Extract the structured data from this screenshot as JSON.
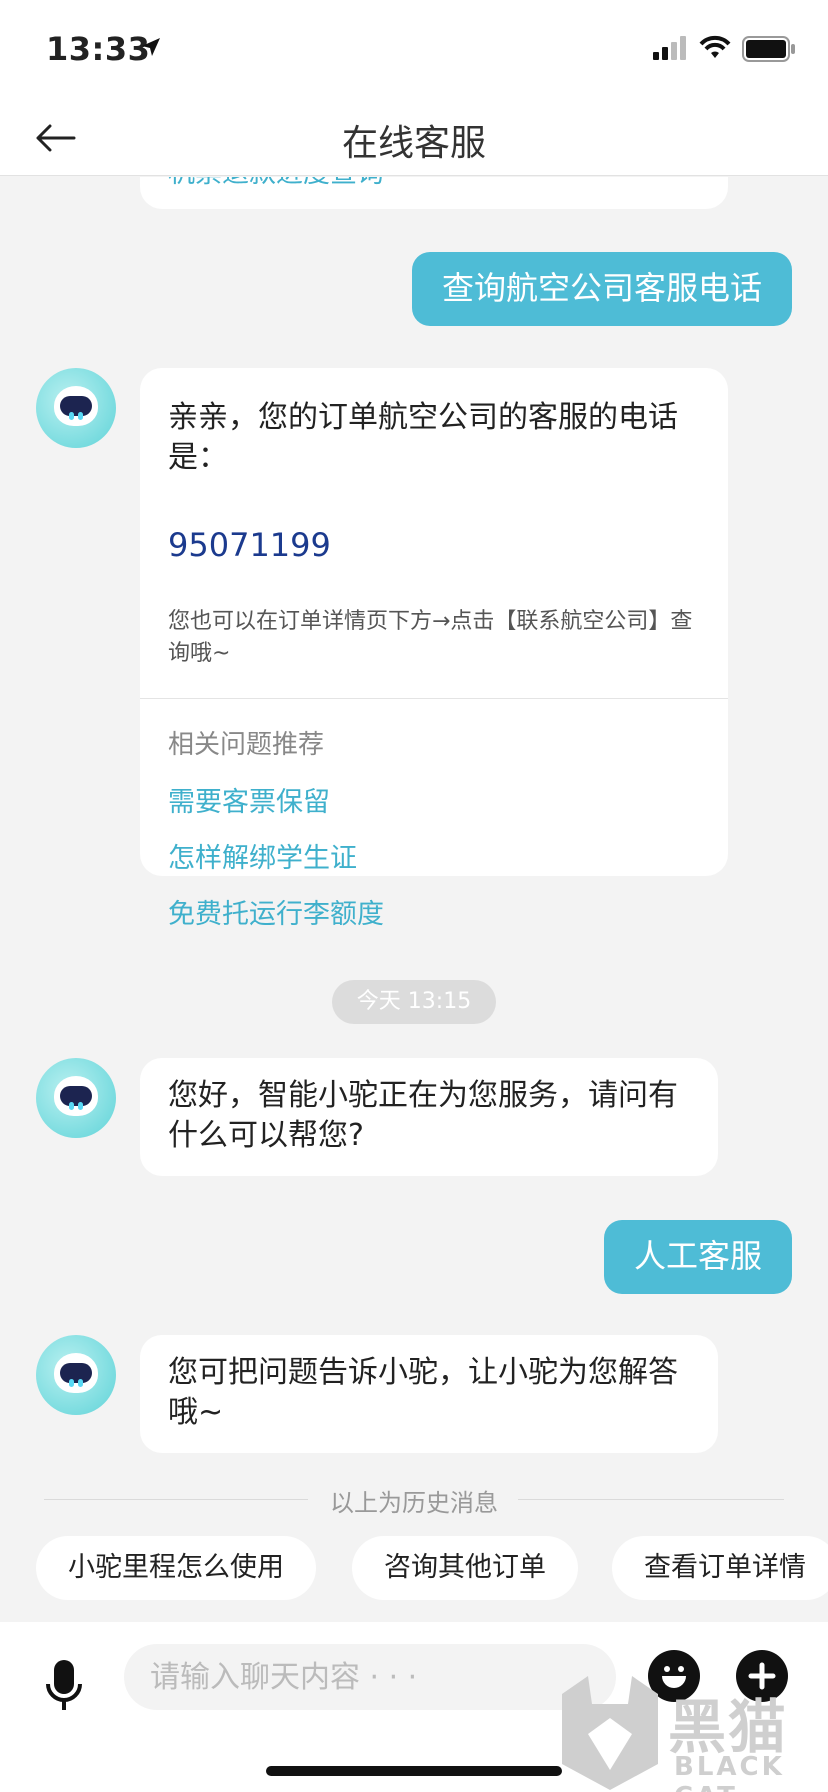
{
  "status_bar": {
    "time": "13:33"
  },
  "nav": {
    "title": "在线客服"
  },
  "chat": {
    "partial_top_text": "机票退款进度查询",
    "user_msg_1": "查询航空公司客服电话",
    "bot_msg_1": {
      "text": "亲亲，您的订单航空公司的客服的电话是：",
      "phone": "95071199",
      "note": "您也可以在订单详情页下方→点击【联系航空公司】查询哦~",
      "related_title": "相关问题推荐",
      "related": [
        "需要客票保留",
        "怎样解绑学生证",
        "免费托运行李额度"
      ]
    },
    "time_label": "今天 13:15",
    "bot_msg_2": "您好，智能小驼正在为您服务，请问有什么可以帮您?",
    "user_msg_2": "人工客服",
    "bot_msg_3": "您可把问题告诉小驼，让小驼为您解答哦~",
    "history_label": "以上为历史消息"
  },
  "quick_actions": [
    "小驼里程怎么使用",
    "咨询其他订单",
    "查看订单详情"
  ],
  "input": {
    "placeholder": "请输入聊天内容 · · ·"
  },
  "watermark": {
    "cn": "黑猫",
    "en": "BLACK CAT"
  },
  "colors": {
    "accent": "#4ebcd6",
    "link": "#3fb0cc",
    "phone": "#1b3a8e"
  }
}
